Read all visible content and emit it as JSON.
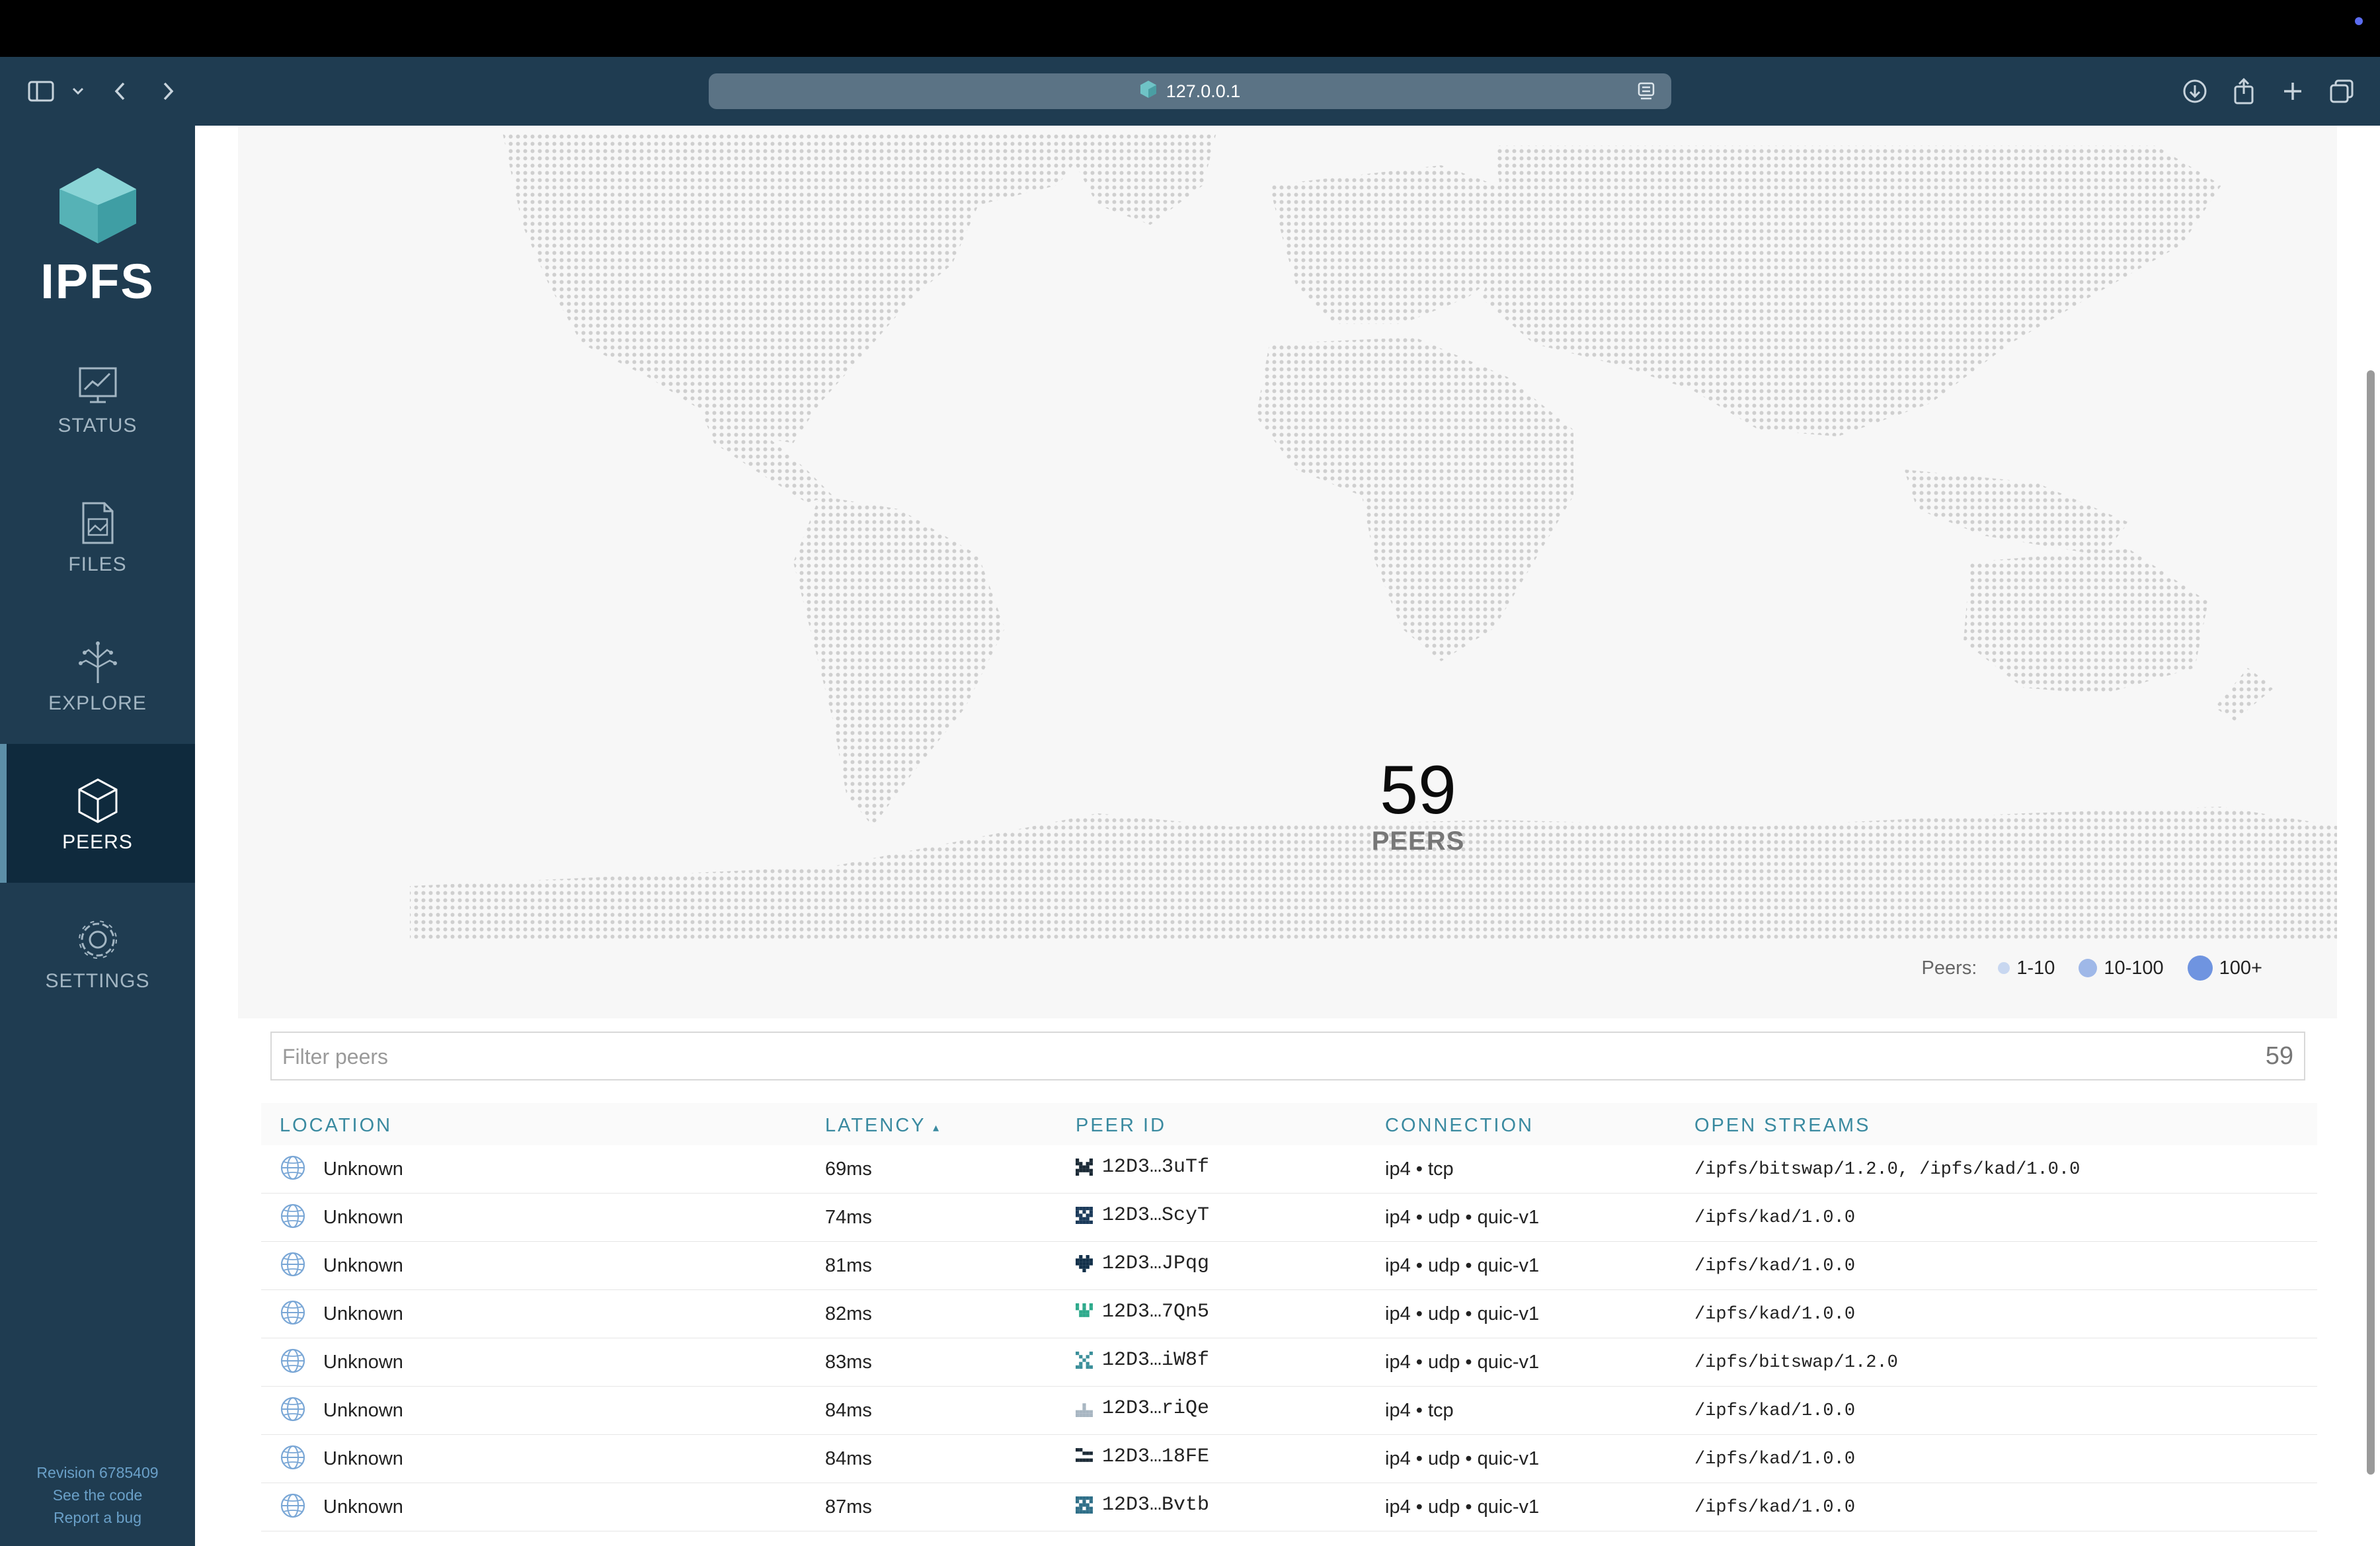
{
  "browser": {
    "url": "127.0.0.1"
  },
  "sidebar": {
    "logo_text": "IPFS",
    "items": [
      {
        "label": "STATUS"
      },
      {
        "label": "FILES"
      },
      {
        "label": "EXPLORE"
      },
      {
        "label": "PEERS"
      },
      {
        "label": "SETTINGS"
      }
    ],
    "active": "PEERS",
    "footer": {
      "revision": "Revision 6785409",
      "see_code": "See the code",
      "report_bug": "Report a bug"
    }
  },
  "map": {
    "peer_count": "59",
    "peer_label": "PEERS",
    "legend": {
      "title": "Peers:",
      "items": [
        "1-10",
        "10-100",
        "100+"
      ]
    }
  },
  "filter": {
    "placeholder": "Filter peers",
    "count": "59"
  },
  "table": {
    "headers": {
      "location": "LOCATION",
      "latency": "LATENCY",
      "latency_sort": "▴",
      "peer_id": "PEER ID",
      "connection": "CONNECTION",
      "open_streams": "OPEN STREAMS"
    },
    "rows": [
      {
        "location": "Unknown",
        "latency": "69ms",
        "peer_id": "12D3…3uTf",
        "connection": "ip4 • tcp",
        "streams": "/ipfs/bitswap/1.2.0, /ipfs/kad/1.0.0",
        "icon_color": "#1b2a36"
      },
      {
        "location": "Unknown",
        "latency": "74ms",
        "peer_id": "12D3…ScyT",
        "connection": "ip4 • udp • quic-v1",
        "streams": "/ipfs/kad/1.0.0",
        "icon_color": "#1b3a5a"
      },
      {
        "location": "Unknown",
        "latency": "81ms",
        "peer_id": "12D3…JPqg",
        "connection": "ip4 • udp • quic-v1",
        "streams": "/ipfs/kad/1.0.0",
        "icon_color": "#12304a"
      },
      {
        "location": "Unknown",
        "latency": "82ms",
        "peer_id": "12D3…7Qn5",
        "connection": "ip4 • udp • quic-v1",
        "streams": "/ipfs/kad/1.0.0",
        "icon_color": "#2eaa8c"
      },
      {
        "location": "Unknown",
        "latency": "83ms",
        "peer_id": "12D3…iW8f",
        "connection": "ip4 • udp • quic-v1",
        "streams": "/ipfs/bitswap/1.2.0",
        "icon_color": "#3b8f9a"
      },
      {
        "location": "Unknown",
        "latency": "84ms",
        "peer_id": "12D3…riQe",
        "connection": "ip4 • tcp",
        "streams": "/ipfs/kad/1.0.0",
        "icon_color": "#a8b6c2"
      },
      {
        "location": "Unknown",
        "latency": "84ms",
        "peer_id": "12D3…18FE",
        "connection": "ip4 • udp • quic-v1",
        "streams": "/ipfs/kad/1.0.0",
        "icon_color": "#1b2a36"
      },
      {
        "location": "Unknown",
        "latency": "87ms",
        "peer_id": "12D3…Bvtb",
        "connection": "ip4 • udp • quic-v1",
        "streams": "/ipfs/kad/1.0.0",
        "icon_color": "#2f6f88"
      }
    ]
  },
  "colors": {
    "sidebar_bg": "#1f3c51",
    "accent": "#3a8aa0",
    "legend_dot": "#7aa0e0"
  }
}
